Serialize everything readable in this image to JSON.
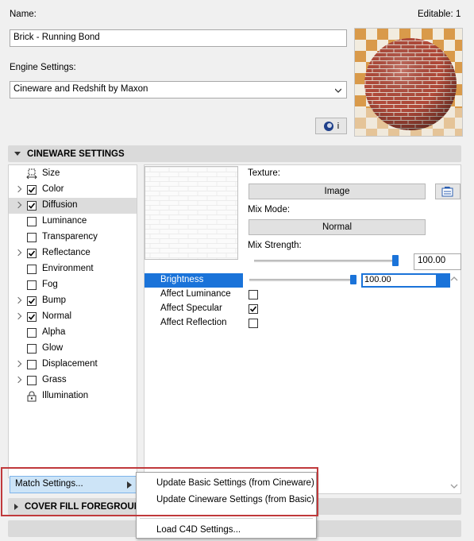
{
  "header": {
    "name_label": "Name:",
    "editable_label": "Editable: 1",
    "name_value": "Brick - Running Bond",
    "engine_label": "Engine Settings:",
    "engine_value": "Cineware and Redshift by Maxon",
    "info_icon_letter": "i"
  },
  "sections": {
    "cineware_title": "CINEWARE SETTINGS",
    "cover_fill_title": "COVER FILL FOREGROUND"
  },
  "channels": [
    {
      "label": "Size",
      "expandable": false,
      "checkbox": "none",
      "icon": "size-icon"
    },
    {
      "label": "Color",
      "expandable": true,
      "checkbox": "checked"
    },
    {
      "label": "Diffusion",
      "expandable": true,
      "checkbox": "checked",
      "selected": true
    },
    {
      "label": "Luminance",
      "expandable": false,
      "checkbox": "unchecked"
    },
    {
      "label": "Transparency",
      "expandable": false,
      "checkbox": "unchecked"
    },
    {
      "label": "Reflectance",
      "expandable": true,
      "checkbox": "checked"
    },
    {
      "label": "Environment",
      "expandable": false,
      "checkbox": "unchecked"
    },
    {
      "label": "Fog",
      "expandable": false,
      "checkbox": "unchecked"
    },
    {
      "label": "Bump",
      "expandable": true,
      "checkbox": "checked"
    },
    {
      "label": "Normal",
      "expandable": true,
      "checkbox": "checked"
    },
    {
      "label": "Alpha",
      "expandable": false,
      "checkbox": "unchecked"
    },
    {
      "label": "Glow",
      "expandable": false,
      "checkbox": "unchecked"
    },
    {
      "label": "Displacement",
      "expandable": true,
      "checkbox": "unchecked"
    },
    {
      "label": "Grass",
      "expandable": true,
      "checkbox": "unchecked"
    },
    {
      "label": "Illumination",
      "expandable": false,
      "checkbox": "none",
      "icon": "lock-icon"
    }
  ],
  "texture": {
    "texture_label": "Texture:",
    "texture_button": "Image",
    "mix_mode_label": "Mix Mode:",
    "mix_mode_value": "Normal",
    "mix_strength_label": "Mix Strength:",
    "mix_strength_value": "100.00",
    "mix_strength_fraction": 1.0
  },
  "properties": {
    "brightness_label": "Brightness",
    "brightness_value": "100.00",
    "brightness_fraction": 1.0,
    "rows": [
      {
        "label": "Affect Luminance",
        "checked": false
      },
      {
        "label": "Affect Specular",
        "checked": true
      },
      {
        "label": "Affect Reflection",
        "checked": false
      }
    ]
  },
  "match": {
    "button_label": "Match Settings...",
    "menu": [
      "Update Basic Settings (from Cineware)",
      "Update Cineware Settings (from Basic)",
      "Load C4D Settings..."
    ]
  },
  "colors": {
    "selection_blue": "#1a73d9",
    "highlight_frame": "#c0393b",
    "brick": "#b24a3a"
  }
}
